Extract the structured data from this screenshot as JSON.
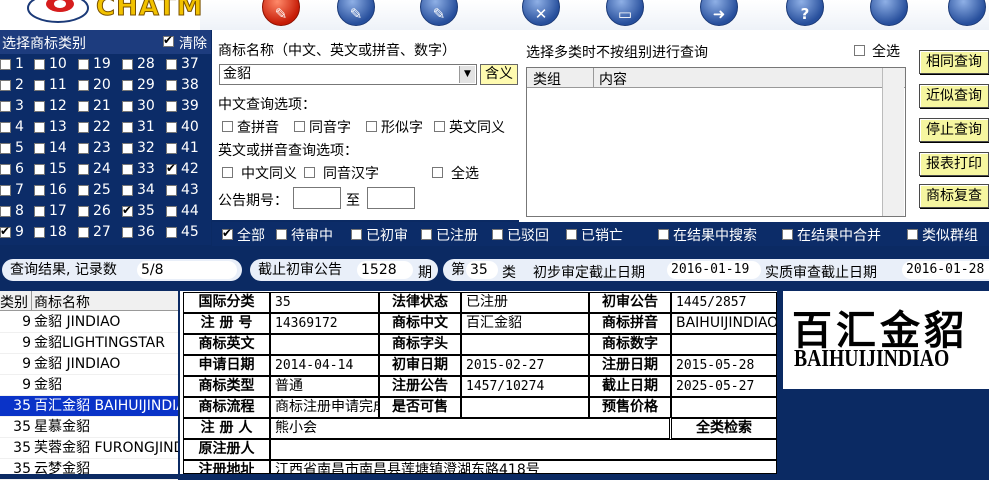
{
  "app": {
    "logo_text": "CHATM"
  },
  "toolbar": {
    "buttons": [
      {
        "icon": "pen-icon",
        "glyph": "✎",
        "active": true
      },
      {
        "icon": "pen-icon",
        "glyph": "✎"
      },
      {
        "icon": "pen-icon",
        "glyph": "✎"
      },
      {
        "icon": "tools-icon",
        "glyph": "✕"
      },
      {
        "icon": "keyboard-icon",
        "glyph": "▭"
      },
      {
        "icon": "arrow-right-icon",
        "glyph": "➜"
      },
      {
        "icon": "help-icon",
        "glyph": "?"
      },
      {
        "icon": "circle-icon",
        "glyph": ""
      },
      {
        "icon": "circle-icon",
        "glyph": ""
      }
    ]
  },
  "categories": {
    "title": "选择商标类别",
    "clear_label": "清除",
    "clear_checked": true,
    "items": [
      {
        "n": "1",
        "checked": false
      },
      {
        "n": "10",
        "checked": false
      },
      {
        "n": "19",
        "checked": false
      },
      {
        "n": "28",
        "checked": false
      },
      {
        "n": "37",
        "checked": false
      },
      {
        "n": "2",
        "checked": false
      },
      {
        "n": "11",
        "checked": false
      },
      {
        "n": "20",
        "checked": false
      },
      {
        "n": "29",
        "checked": false
      },
      {
        "n": "38",
        "checked": false
      },
      {
        "n": "3",
        "checked": false
      },
      {
        "n": "12",
        "checked": false
      },
      {
        "n": "21",
        "checked": false
      },
      {
        "n": "30",
        "checked": false
      },
      {
        "n": "39",
        "checked": false
      },
      {
        "n": "4",
        "checked": false
      },
      {
        "n": "13",
        "checked": false
      },
      {
        "n": "22",
        "checked": false
      },
      {
        "n": "31",
        "checked": false
      },
      {
        "n": "40",
        "checked": false
      },
      {
        "n": "5",
        "checked": false
      },
      {
        "n": "14",
        "checked": false
      },
      {
        "n": "23",
        "checked": false
      },
      {
        "n": "32",
        "checked": false
      },
      {
        "n": "41",
        "checked": false
      },
      {
        "n": "6",
        "checked": false
      },
      {
        "n": "15",
        "checked": false
      },
      {
        "n": "24",
        "checked": false
      },
      {
        "n": "33",
        "checked": false
      },
      {
        "n": "42",
        "checked": true
      },
      {
        "n": "7",
        "checked": false
      },
      {
        "n": "16",
        "checked": false
      },
      {
        "n": "25",
        "checked": false
      },
      {
        "n": "34",
        "checked": false
      },
      {
        "n": "43",
        "checked": false
      },
      {
        "n": "8",
        "checked": false
      },
      {
        "n": "17",
        "checked": false
      },
      {
        "n": "26",
        "checked": false
      },
      {
        "n": "35",
        "checked": true
      },
      {
        "n": "44",
        "checked": false
      },
      {
        "n": "9",
        "checked": true
      },
      {
        "n": "18",
        "checked": false
      },
      {
        "n": "27",
        "checked": false
      },
      {
        "n": "36",
        "checked": false
      },
      {
        "n": "45",
        "checked": false
      }
    ]
  },
  "search": {
    "name_label": "商标名称（中文、英文或拼音、数字）",
    "name_value": "金貂",
    "meaning_button": "含义",
    "cn_options_label": "中文查询选项：",
    "cn_options": [
      {
        "label": "查拼音",
        "checked": false
      },
      {
        "label": "同音字",
        "checked": false
      },
      {
        "label": "形似字",
        "checked": false
      },
      {
        "label": "英文同义",
        "checked": false
      }
    ],
    "en_options_label": "英文或拼音查询选项：",
    "en_options": [
      {
        "label": "中文同义",
        "checked": false
      },
      {
        "label": "同音汉字",
        "checked": false
      },
      {
        "label": "全选",
        "checked": false
      }
    ],
    "gazette_label": "公告期号：",
    "gazette_from": "",
    "gazette_to_label": "至",
    "gazette_to": ""
  },
  "multi": {
    "note": "选择多类时不按组别进行查询",
    "select_all_label": "全选",
    "select_all_checked": false,
    "col_group": "类组",
    "col_content": "内容"
  },
  "side_buttons": [
    "相同查询",
    "近似查询",
    "停止查询",
    "报表打印",
    "商标复查"
  ],
  "filters": [
    {
      "label": "全部",
      "checked": true
    },
    {
      "label": "待审中",
      "checked": false
    },
    {
      "label": "已初审",
      "checked": false
    },
    {
      "label": "已注册",
      "checked": false
    },
    {
      "label": "已驳回",
      "checked": false
    },
    {
      "label": "已销亡",
      "checked": false
    },
    {
      "label": "在结果中搜索",
      "checked": false
    },
    {
      "label": "在结果中合并",
      "checked": false
    },
    {
      "label": "类似群组",
      "checked": false
    }
  ],
  "result_bar": {
    "count_label": "查询结果, 记录数",
    "count_value": "5/8",
    "deadline_label": "截止初审公告",
    "deadline_value": "1528",
    "deadline_unit": "期",
    "class_prefix": "第",
    "class_value": "35",
    "class_suffix": "类",
    "prelim_label": "初步审定截止日期",
    "prelim_date": "2016-01-19",
    "substantive_label": "实质审查截止日期",
    "substantive_date": "2016-01-28"
  },
  "results": {
    "col_class": "类别",
    "col_name": "商标名称",
    "rows": [
      {
        "cls": "9",
        "name": "金貂 JINDIAO",
        "selected": false
      },
      {
        "cls": "9",
        "name": "金貂LIGHTINGSTAR",
        "selected": false
      },
      {
        "cls": "9",
        "name": "金貂 JINDIAO",
        "selected": false
      },
      {
        "cls": "9",
        "name": "金貂",
        "selected": false
      },
      {
        "cls": "35",
        "name": "百汇金貂 BAIHUIJINDIAO",
        "selected": true
      },
      {
        "cls": "35",
        "name": "星慕金貂",
        "selected": false
      },
      {
        "cls": "35",
        "name": "芙蓉金貂 FURONGJINDIAO",
        "selected": false
      },
      {
        "cls": "35",
        "name": "云梦金貂",
        "selected": false
      }
    ]
  },
  "detail": {
    "intl_class_label": "国际分类",
    "intl_class": "35",
    "legal_status_label": "法律状态",
    "legal_status": "已注册",
    "prelim_pub_label": "初审公告",
    "prelim_pub": "1445/2857",
    "reg_no_label": "注 册 号",
    "reg_no": "14369172",
    "tm_cn_label": "商标中文",
    "tm_cn": "百汇金貂",
    "tm_pinyin_label": "商标拼音",
    "tm_pinyin": "BAIHUIJINDIAO",
    "tm_en_label": "商标英文",
    "tm_en": "",
    "tm_letters_label": "商标字头",
    "tm_letters": "",
    "tm_digits_label": "商标数字",
    "tm_digits": "",
    "apply_date_label": "申请日期",
    "apply_date": "2014-04-14",
    "prelim_date_label": "初审日期",
    "prelim_date": "2015-02-27",
    "reg_date_label": "注册日期",
    "reg_date": "2015-05-28",
    "tm_type_label": "商标类型",
    "tm_type": "普通",
    "reg_pub_label": "注册公告",
    "reg_pub": "1457/10274",
    "expiry_label": "截止日期",
    "expiry": "2025-05-27",
    "flow_label": "商标流程",
    "flow": "商标注册申请完成",
    "available_label": "是否可售",
    "available": "",
    "presale_label": "预售价格",
    "presale": "",
    "registrant_label": "注 册 人",
    "registrant": "熊小会",
    "all_class_label": "全类检索",
    "orig_registrant_label": "原注册人",
    "orig_registrant": "",
    "address_label": "注册地址",
    "address": "江西省南昌市南昌县莲塘镇澄湖东路418号"
  },
  "trademark_image": {
    "cn": "百汇金貂",
    "en": "BAIHUIJINDIAO"
  }
}
